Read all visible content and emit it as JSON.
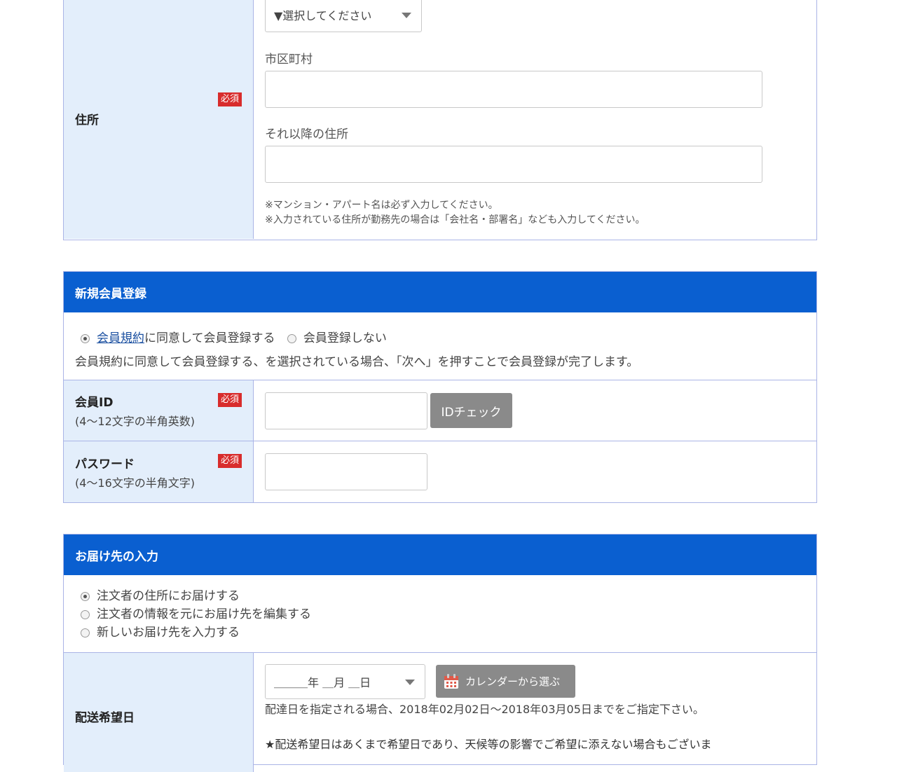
{
  "address": {
    "label": "住所",
    "required_badge": "必須",
    "prefecture_select": "▼選択してください",
    "city_label": "市区町村",
    "rest_label": "それ以降の住所",
    "note1": "※マンション・アパート名は必ず入力してください。",
    "note2": "※入力されている住所が勤務先の場合は「会社名・部署名」なども入力してください。"
  },
  "member": {
    "header": "新規会員登録",
    "terms_link": "会員規約",
    "agree_suffix": "に同意して会員登録する",
    "no_register": "会員登録しない",
    "info": "会員規約に同意して会員登録する、を選択されている場合、「次へ」を押すことで会員登録が完了します。",
    "id_label": "会員ID",
    "id_sub": "(4〜12文字の半角英数)",
    "id_check_button": "IDチェック",
    "password_label": "パスワード",
    "password_sub": "(4〜16文字の半角文字)",
    "required_badge": "必須"
  },
  "delivery": {
    "header": "お届け先の入力",
    "options": [
      "注文者の住所にお届けする",
      "注文者の情報を元にお届け先を編集する",
      "新しいお届け先を入力する"
    ],
    "date_label": "配送希望日",
    "date_select": "＿＿＿年 ＿月 ＿日",
    "calendar_button": "カレンダーから選ぶ",
    "date_note": "配達日を指定される場合、2018年02月02日〜2018年03月05日までをご指定下さい。",
    "date_note2": "★配送希望日はあくまで希望日であり、天候等の影響でご希望に添えない場合もございま"
  },
  "colors": {
    "header_blue": "#0a5fd0",
    "label_bg": "#e3eefb",
    "required_red": "#d82c2c",
    "border": "#aab4e6"
  }
}
